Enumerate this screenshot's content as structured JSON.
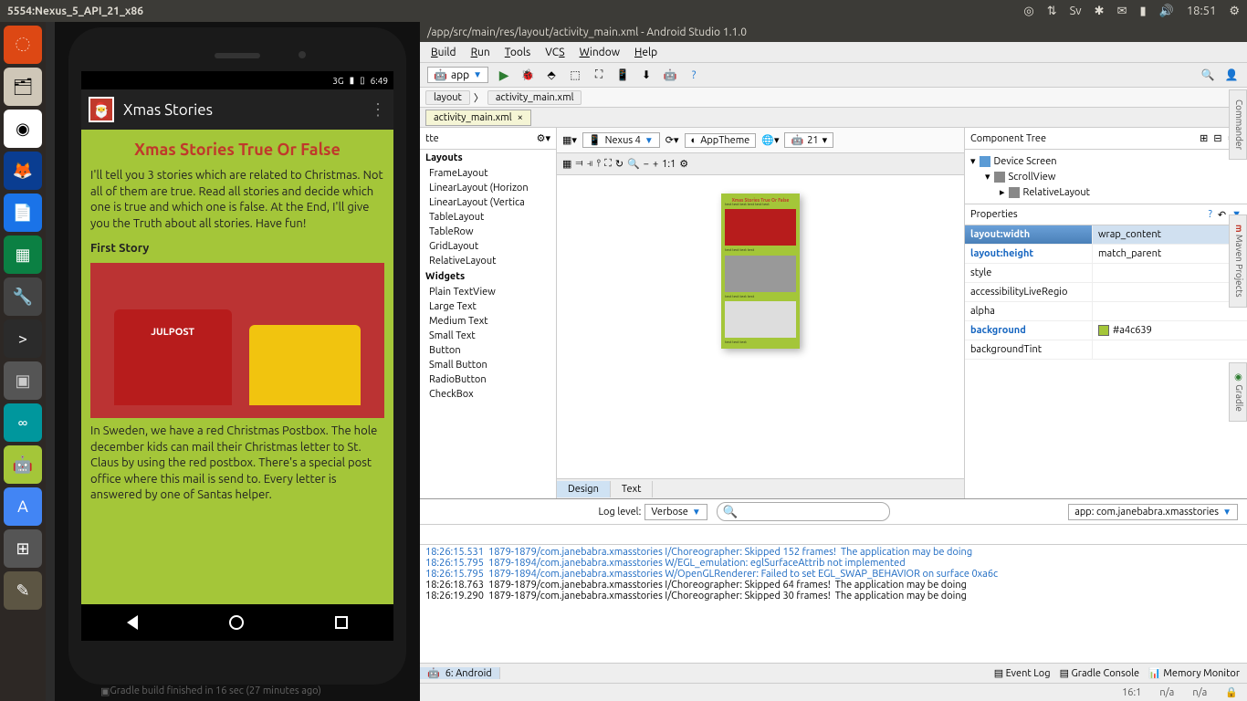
{
  "topbar": {
    "title": "5554:Nexus_5_API_21_x86",
    "time": "18:51"
  },
  "launcher": {
    "items": [
      "ubuntu",
      "files",
      "chrome",
      "firefox",
      "writer",
      "calc",
      "settings",
      "terminal",
      "misc",
      "arduino",
      "android",
      "androidstudio",
      "calc2",
      "gimp"
    ]
  },
  "emulator": {
    "statusbar": {
      "signal": "3G",
      "time": "6:49"
    },
    "app_title": "Xmas Stories",
    "heading": "Xmas Stories True Or False",
    "intro": "I'll tell you 3 stories which are related to Christmas. Not all of them are true. Read all stories and decide which one is true and which one is false. At the End, I'll give you the Truth about all stories. Have fun!",
    "story1_label": "First Story",
    "story1_text": "In Sweden, we have a red Christmas Postbox. The hole december kids can mail their Christmas letter to St. Claus by using the red postbox. There's a special post office where this mail is send to. Every letter is answered by one of Santas helper."
  },
  "studio": {
    "title": "/app/src/main/res/layout/activity_main.xml - Android Studio 1.1.0",
    "menu": [
      "Build",
      "Run",
      "Tools",
      "VCS",
      "Window",
      "Help"
    ],
    "run_config": "app",
    "breadcrumb": [
      "layout",
      "activity_main.xml"
    ],
    "tab": "activity_main.xml",
    "palette_title": "tte",
    "palette": {
      "layouts_label": "Layouts",
      "layouts": [
        "FrameLayout",
        "LinearLayout (Horizon",
        "LinearLayout (Vertica",
        "TableLayout",
        "TableRow",
        "GridLayout",
        "RelativeLayout"
      ],
      "widgets_label": "Widgets",
      "widgets": [
        "Plain TextView",
        "Large Text",
        "Medium Text",
        "Small Text",
        "Button",
        "Small Button",
        "RadioButton",
        "CheckBox"
      ]
    },
    "design_toolbar": {
      "device": "Nexus 4",
      "theme": "AppTheme",
      "api": "21"
    },
    "design_tabs": {
      "design": "Design",
      "text": "Text"
    },
    "tree_title": "Component Tree",
    "tree": {
      "root": "Device Screen",
      "n1": "ScrollView",
      "n2": "RelativeLayout"
    },
    "props_title": "Properties",
    "props": [
      {
        "k": "layout:width",
        "v": "wrap_content",
        "req": true,
        "sel": true
      },
      {
        "k": "layout:height",
        "v": "match_parent",
        "req": true
      },
      {
        "k": "style",
        "v": ""
      },
      {
        "k": "accessibilityLiveRegio",
        "v": ""
      },
      {
        "k": "alpha",
        "v": ""
      },
      {
        "k": "background",
        "v": "#a4c639",
        "req": true,
        "swatch": true
      },
      {
        "k": "backgroundTint",
        "v": ""
      }
    ],
    "side_tabs": [
      "Commander",
      "Maven Projects",
      "Gradle"
    ],
    "logcat": {
      "label": "Log level:",
      "level": "Verbose",
      "process": "app: com.janebabra.xmasstories",
      "lines": [
        {
          "t": "18:26:15.531",
          "c": "blue",
          "body": "  1879-1879/com.janebabra.xmasstories I/Choreographer: Skipped 152 frames!  The application may be doing"
        },
        {
          "t": "18:26:15.795",
          "c": "blue",
          "body": "  1879-1894/com.janebabra.xmasstories W/EGL_emulation: eglSurfaceAttrib not implemented"
        },
        {
          "t": "18:26:15.795",
          "c": "blue",
          "body": "  1879-1894/com.janebabra.xmasstories W/OpenGLRenderer: Failed to set EGL_SWAP_BEHAVIOR on surface 0xa6c"
        },
        {
          "t": "18:26:18.763",
          "c": "black",
          "body": "  1879-1879/com.janebabra.xmasstories I/Choreographer: Skipped 64 frames!  The application may be doing"
        },
        {
          "t": "18:26:19.290",
          "c": "black",
          "body": "  1879-1879/com.janebabra.xmasstories I/Choreographer: Skipped 30 frames!  The application may be doing"
        }
      ]
    },
    "bottom": {
      "android_tab": "6: Android",
      "event_log": "Event Log",
      "gradle_console": "Gradle Console",
      "memory_monitor": "Memory Monitor",
      "below_emu": "Gradle build finished in 16 sec (27 minutes ago)",
      "pos": "16:1",
      "na1": "n/a",
      "na2": "n/a"
    }
  }
}
